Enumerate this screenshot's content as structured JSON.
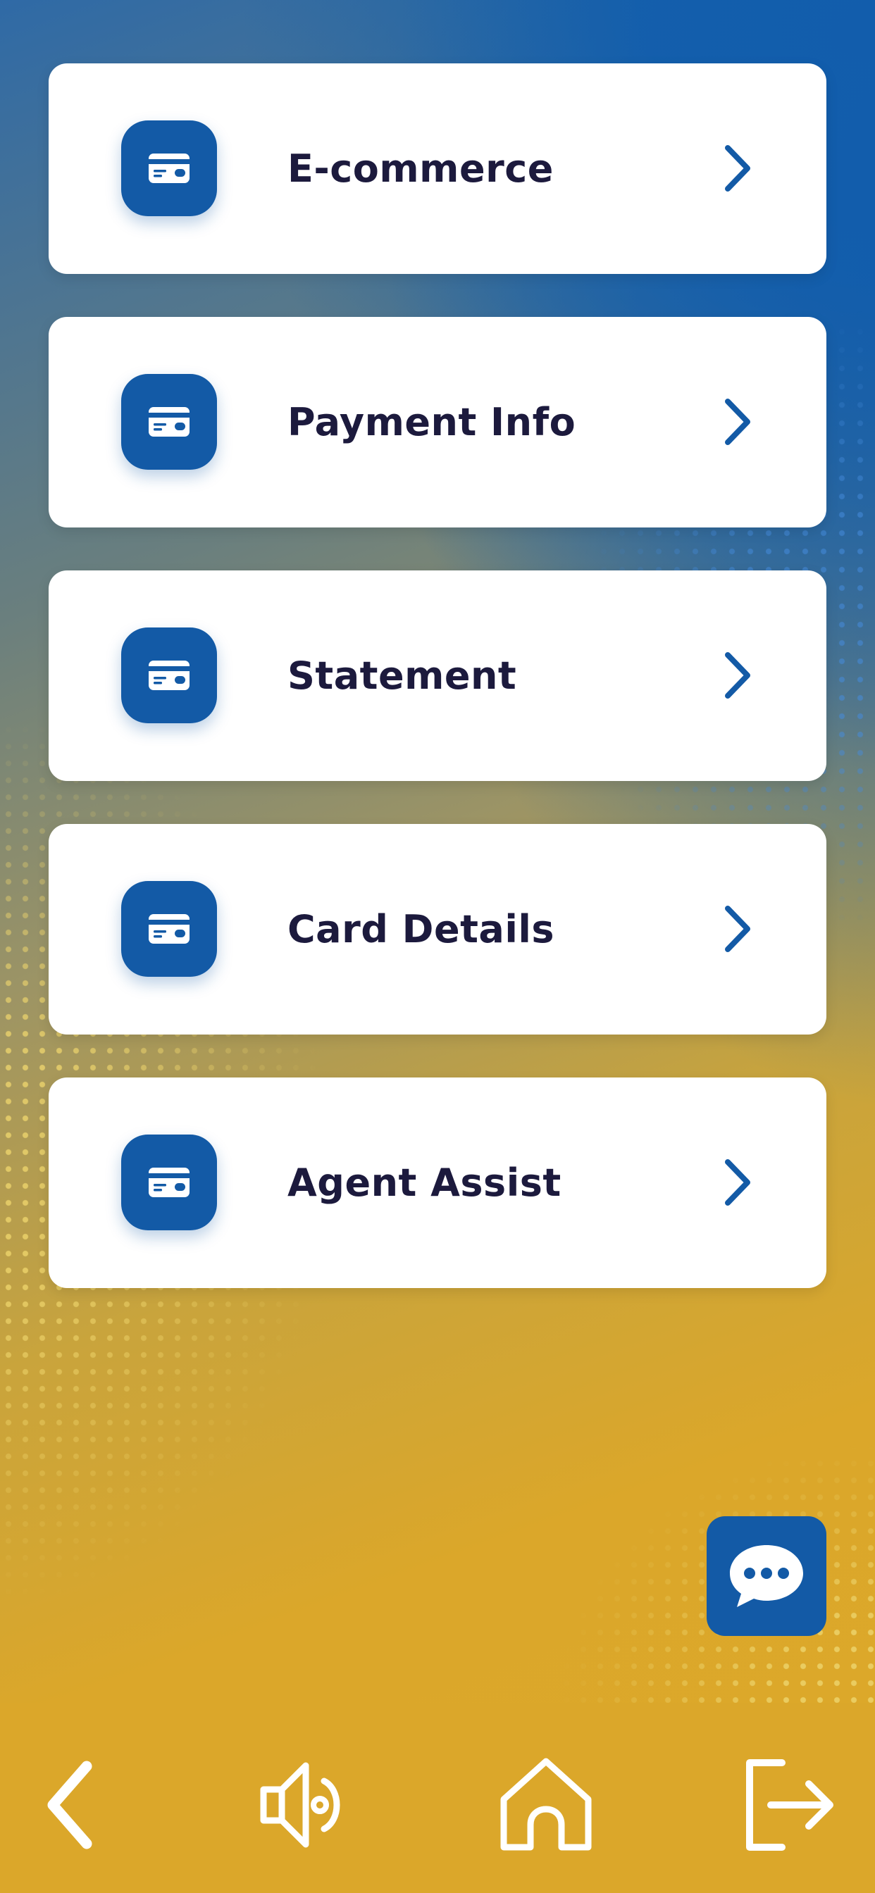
{
  "theme": {
    "primary": "#135aa6",
    "accent_yellow": "#dba72a",
    "card_bg": "#ffffff",
    "label_color": "#1c1a3d"
  },
  "menu": {
    "items": [
      {
        "label": "E-commerce",
        "icon": "credit-card-icon",
        "trailing_icon": "chevron-right-icon"
      },
      {
        "label": "Payment Info",
        "icon": "credit-card-icon",
        "trailing_icon": "chevron-right-icon"
      },
      {
        "label": "Statement",
        "icon": "credit-card-icon",
        "trailing_icon": "chevron-right-icon"
      },
      {
        "label": "Card Details",
        "icon": "credit-card-icon",
        "trailing_icon": "chevron-right-icon"
      },
      {
        "label": "Agent Assist",
        "icon": "credit-card-icon",
        "trailing_icon": "chevron-right-icon"
      }
    ]
  },
  "chat": {
    "icon": "chat-bubble-icon"
  },
  "bottom_nav": {
    "items": [
      {
        "icon": "back-chevron-icon"
      },
      {
        "icon": "speaker-icon"
      },
      {
        "icon": "home-icon"
      },
      {
        "icon": "logout-icon"
      }
    ]
  }
}
